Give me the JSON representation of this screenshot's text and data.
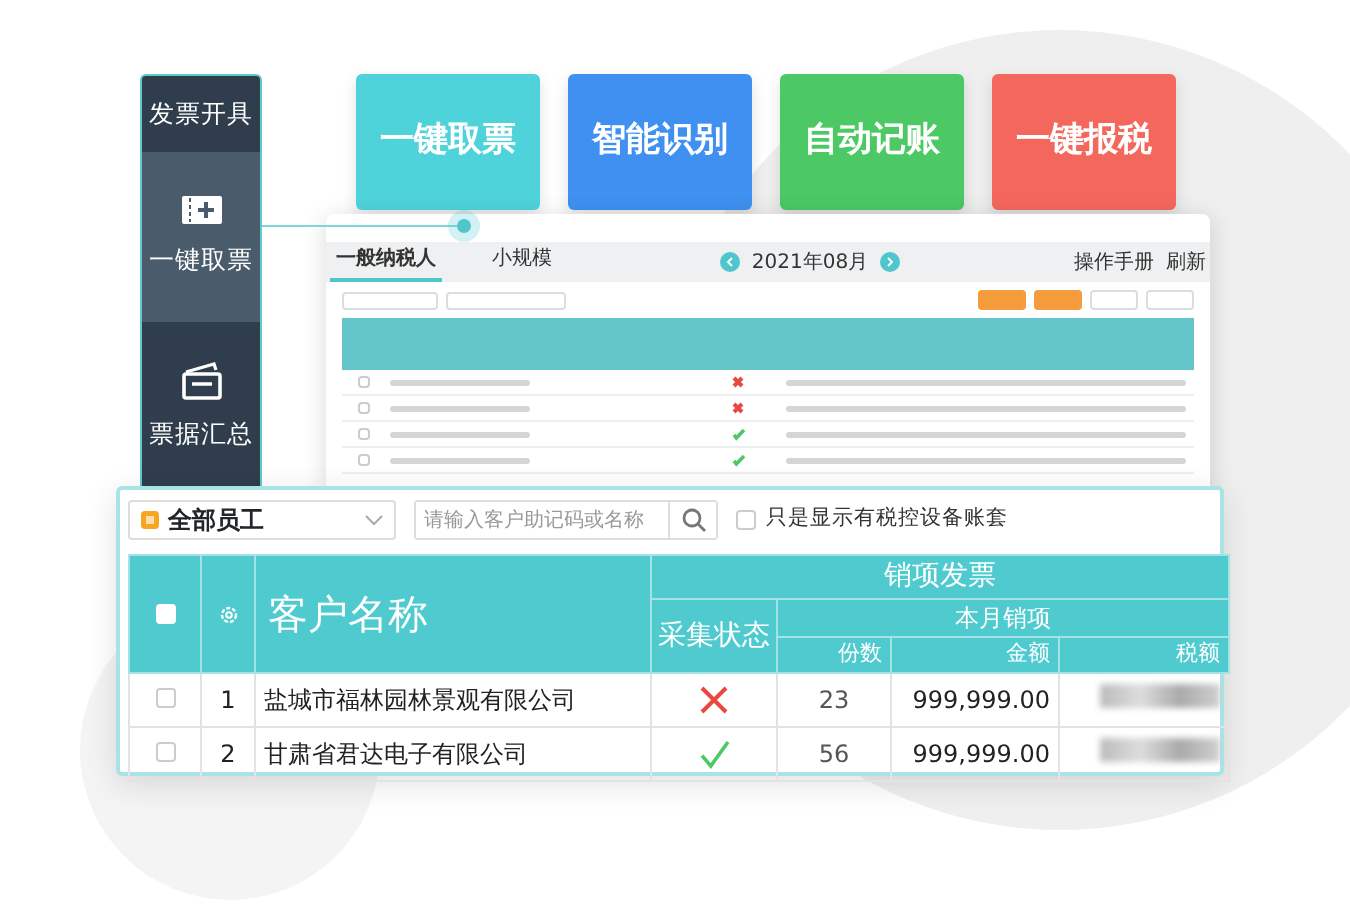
{
  "sidebar": {
    "items": [
      {
        "label": "发票开具",
        "selected": false,
        "kind": "heading"
      },
      {
        "label": "一键取票",
        "selected": true,
        "kind": "ticket"
      },
      {
        "label": "票据汇总",
        "selected": false,
        "kind": "summary"
      }
    ]
  },
  "features": [
    {
      "label": "一键取票",
      "color": "#4fd3db"
    },
    {
      "label": "智能识别",
      "color": "#3f90f0"
    },
    {
      "label": "自动记账",
      "color": "#4cc864"
    },
    {
      "label": "一键报税",
      "color": "#f4675c"
    }
  ],
  "back_window": {
    "tabs": [
      {
        "label": "一般纳税人",
        "selected": true
      },
      {
        "label": "小规模",
        "selected": false
      }
    ],
    "period": "2021年08月",
    "links": [
      "操作手册",
      "刷新"
    ],
    "rows": [
      {
        "selected": false,
        "collected": false
      },
      {
        "selected": false,
        "collected": false
      },
      {
        "selected": false,
        "collected": true
      },
      {
        "selected": false,
        "collected": true
      }
    ]
  },
  "front_window": {
    "employee_select": "全部员工",
    "search": {
      "placeholder": "请输入客户助记码或名称"
    },
    "filter": {
      "label": "只是显示有税控设备账套",
      "checked": false
    },
    "table": {
      "all_selected": false,
      "group": "销项发票",
      "subgroup": "本月销项",
      "columns": [
        "客户名称",
        "采集状态",
        "份数",
        "金额",
        "税额"
      ],
      "rows": [
        {
          "selected": false,
          "index": "1",
          "name": "盐城市福林园林景观有限公司",
          "collected": false,
          "count": "23",
          "amount": "999,999.00"
        },
        {
          "selected": false,
          "index": "2",
          "name": "甘肃省君达电子有限公司",
          "collected": true,
          "count": "56",
          "amount": "999,999.00"
        }
      ]
    }
  }
}
